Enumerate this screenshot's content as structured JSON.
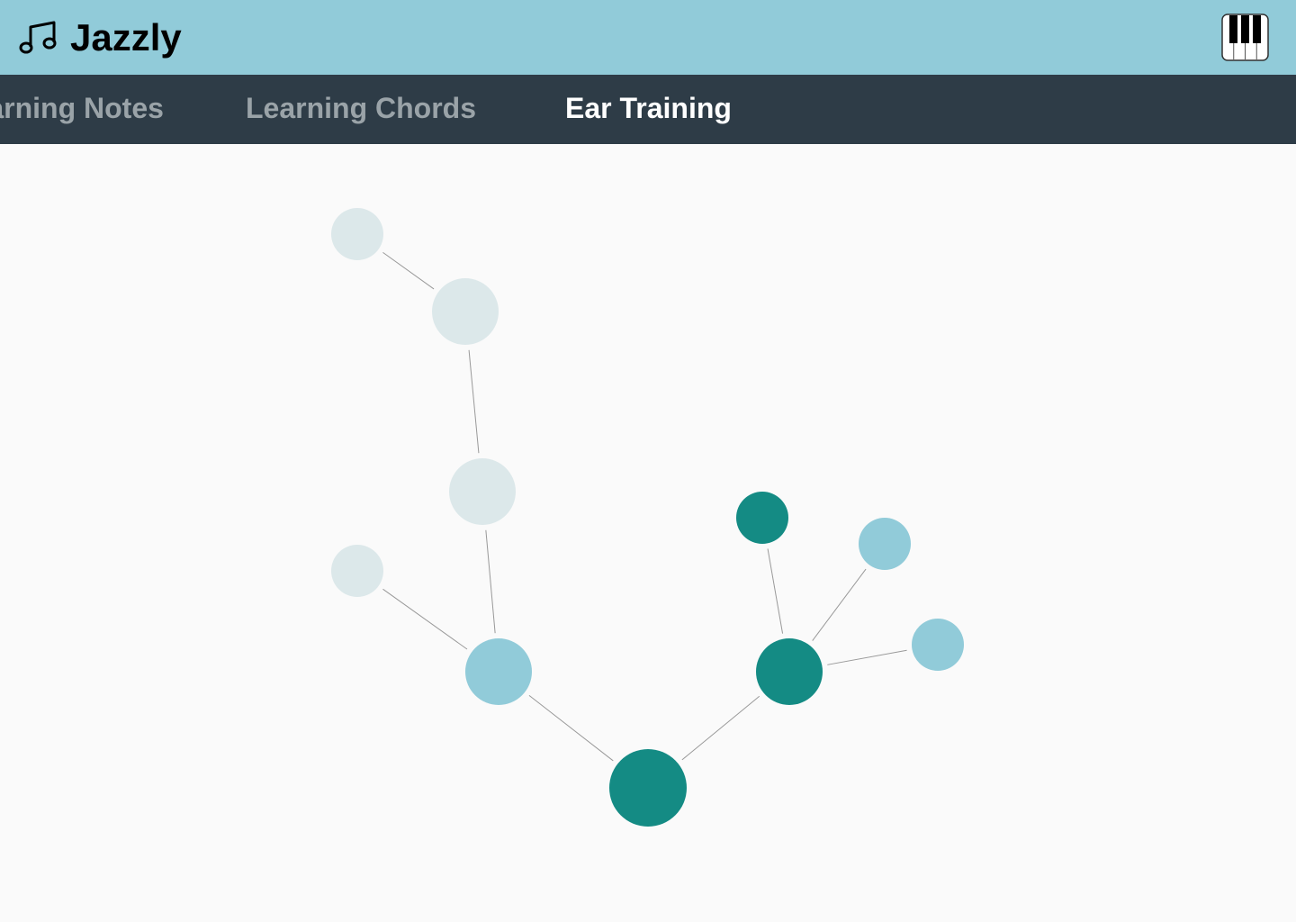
{
  "app": {
    "name": "Jazzly",
    "logo_icon": "music-note-icon",
    "piano_icon": "piano-keys-icon"
  },
  "tabs": [
    {
      "label": "Learning Notes",
      "active": false
    },
    {
      "label": "Learning Chords",
      "active": false
    },
    {
      "label": "Ear Training",
      "active": true
    }
  ],
  "colors": {
    "header": "#91cbd9",
    "tabbar": "#2e3c47",
    "node_complete": "#148b84",
    "node_available": "#91cbd9",
    "node_locked": "#dce8ea",
    "edge": "#999999"
  },
  "graph": {
    "nodes": [
      {
        "id": "root",
        "status": "complete"
      },
      {
        "id": "right-branch",
        "status": "complete"
      },
      {
        "id": "right-top",
        "status": "complete"
      },
      {
        "id": "right-upper-leaf",
        "status": "available"
      },
      {
        "id": "right-lower-leaf",
        "status": "available"
      },
      {
        "id": "left-branch",
        "status": "available"
      },
      {
        "id": "left-leaf",
        "status": "locked"
      },
      {
        "id": "left-mid",
        "status": "locked"
      },
      {
        "id": "left-upper",
        "status": "locked"
      },
      {
        "id": "left-top-leaf",
        "status": "locked"
      }
    ],
    "edges": [
      [
        "root",
        "right-branch"
      ],
      [
        "root",
        "left-branch"
      ],
      [
        "right-branch",
        "right-top"
      ],
      [
        "right-branch",
        "right-upper-leaf"
      ],
      [
        "right-branch",
        "right-lower-leaf"
      ],
      [
        "left-branch",
        "left-leaf"
      ],
      [
        "left-branch",
        "left-mid"
      ],
      [
        "left-mid",
        "left-upper"
      ],
      [
        "left-upper",
        "left-top-leaf"
      ]
    ]
  }
}
